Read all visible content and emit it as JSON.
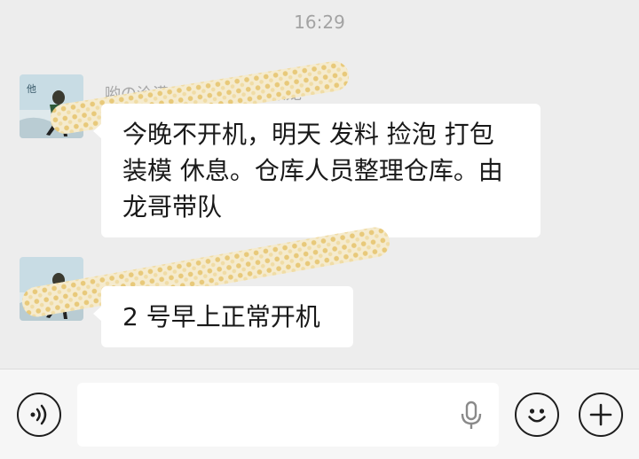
{
  "status": {
    "time": "16:29"
  },
  "messages": [
    {
      "sender": "哟の泠漠",
      "sender_suffix": "员振龙",
      "text": "今晚不开机，明天 发料  捡泡  打包 装模  休息。仓库人员整理仓库。由龙哥带队"
    },
    {
      "sender": "",
      "sender_suffix": "",
      "text": "2 号早上正常开机"
    }
  ],
  "input_bar": {
    "voice_icon": "voice-mode-icon",
    "mic_icon": "microphone-icon",
    "emoji_icon": "emoji-icon",
    "plus_icon": "plus-icon"
  },
  "colors": {
    "background": "#ededed",
    "bubble": "#ffffff",
    "timestamp": "#a3a3a3"
  }
}
